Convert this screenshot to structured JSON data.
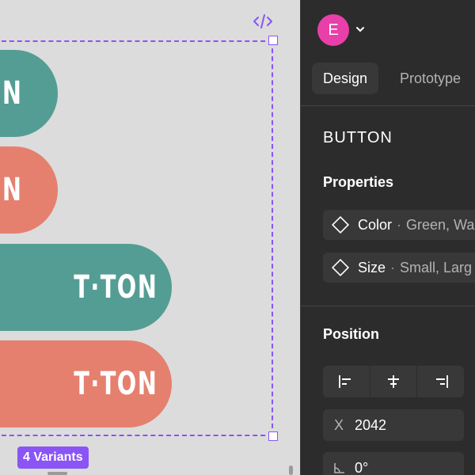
{
  "canvas": {
    "variants": [
      {
        "label": "N",
        "variant": "green-small"
      },
      {
        "label": "N",
        "variant": "salmon-small"
      },
      {
        "label": "T·TON",
        "variant": "green-large"
      },
      {
        "label": "T·TON",
        "variant": "salmon-large"
      }
    ],
    "badge": "4 Variants",
    "accent_color": "#8a55f4",
    "colors": {
      "green": "#549d94",
      "salmon": "#e5806f"
    },
    "code_icon": "code-icon"
  },
  "panel": {
    "user_initial": "E",
    "tabs": {
      "design": "Design",
      "prototype": "Prototype"
    },
    "component_name": "BUTTON",
    "properties": {
      "title": "Properties",
      "items": [
        {
          "name": "Color",
          "values": "Green, Wa",
          "icon": "diamond-icon"
        },
        {
          "name": "Size",
          "values": "Small, Larg",
          "icon": "diamond-icon"
        }
      ]
    },
    "position": {
      "title": "Position",
      "x_label": "X",
      "x_value": "2042",
      "rotation_value": "0°"
    }
  }
}
